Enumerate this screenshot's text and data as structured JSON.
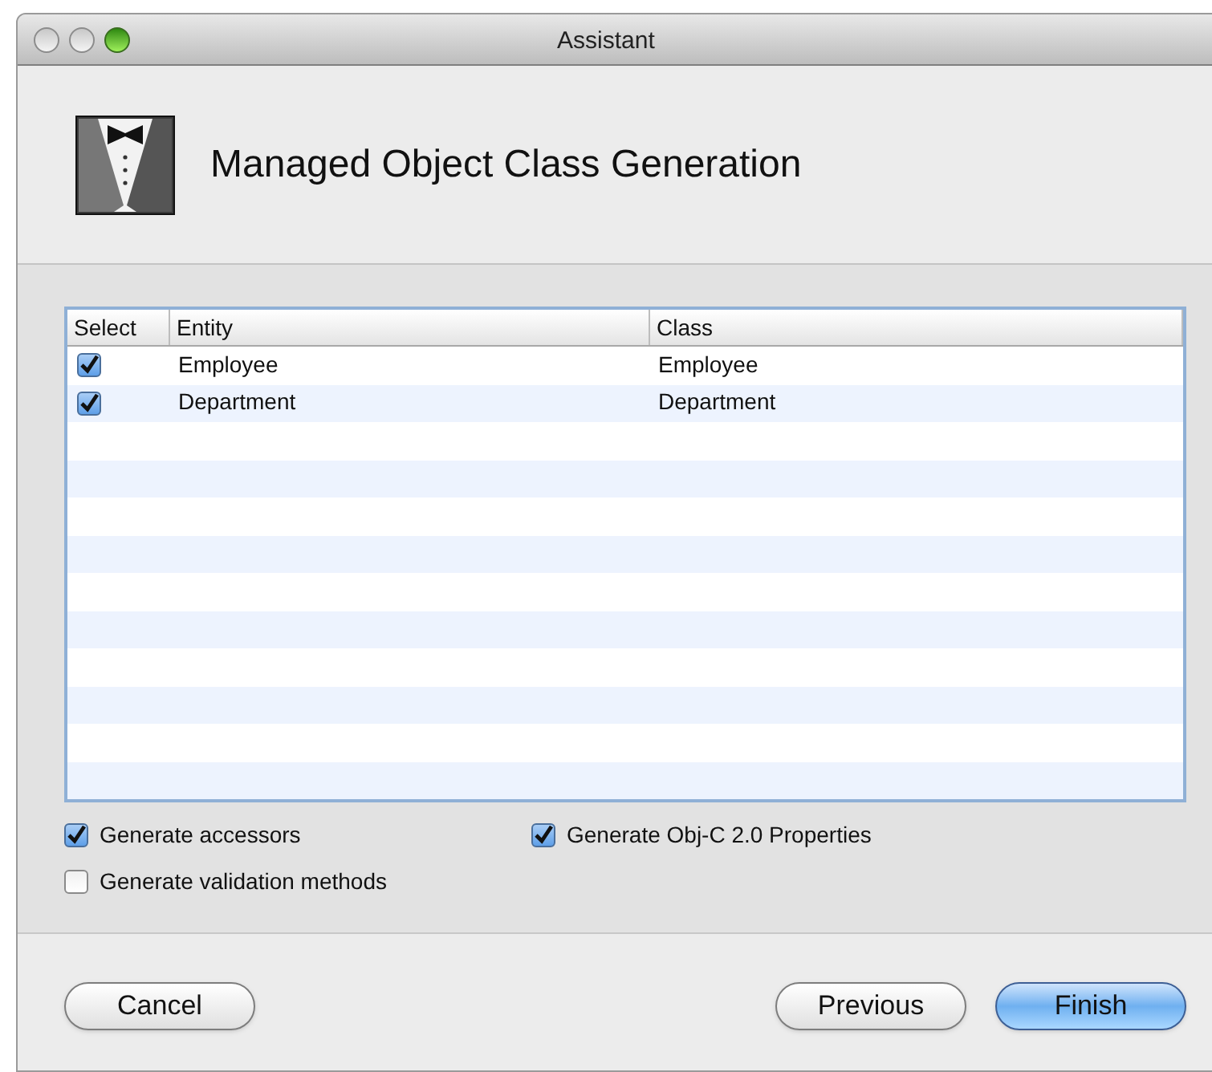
{
  "window": {
    "title": "Assistant"
  },
  "header": {
    "title": "Managed Object Class Generation"
  },
  "table": {
    "columns": [
      "Select",
      "Entity",
      "Class"
    ],
    "rows": [
      {
        "checked": true,
        "entity": "Employee",
        "class": "Employee"
      },
      {
        "checked": true,
        "entity": "Department",
        "class": "Department"
      }
    ]
  },
  "options": [
    {
      "label": "Generate accessors",
      "checked": true
    },
    {
      "label": "Generate Obj-C 2.0 Properties",
      "checked": true
    },
    {
      "label": "Generate validation methods",
      "checked": false
    }
  ],
  "buttons": [
    {
      "label": "Cancel",
      "kind": "normal"
    },
    {
      "label": "Previous",
      "kind": "normal"
    },
    {
      "label": "Finish",
      "kind": "default"
    }
  ]
}
